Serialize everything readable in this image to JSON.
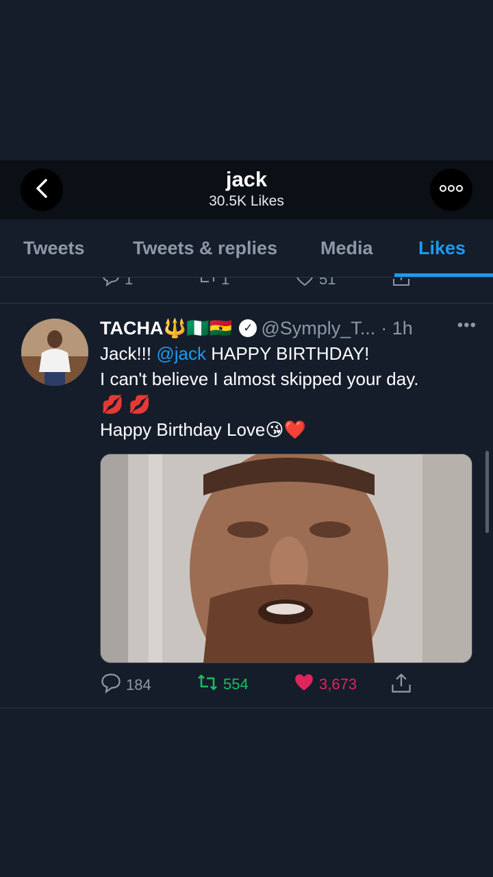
{
  "header": {
    "title": "jack",
    "subtitle": "30.5K Likes",
    "back_icon": "chevron-left-icon",
    "more_icon": "more-horizontal-icon"
  },
  "tabs": [
    {
      "label": "Tweets",
      "active": false
    },
    {
      "label": "Tweets & replies",
      "active": false
    },
    {
      "label": "Media",
      "active": false
    },
    {
      "label": "Likes",
      "active": true
    }
  ],
  "previous_tweet": {
    "replies": "1",
    "retweets": "1",
    "likes": "51"
  },
  "tweet": {
    "author_name": "TACHA🔱🇳🇬🇬🇭",
    "handle": "@Symply_T...",
    "time": "· 1h",
    "line1_prefix": "Jack!!! ",
    "mention": "@jack",
    "line1_suffix": " HAPPY BIRTHDAY!",
    "line2": "I can't believe I almost skipped your day.",
    "line3": "💋 💋",
    "line4": " Happy Birthday Love😘❤️",
    "replies": "184",
    "retweets": "554",
    "likes": "3,673"
  },
  "colors": {
    "background": "#151d2b",
    "accent": "#1d9bf0",
    "retweet": "#17bf63",
    "like": "#e0245e",
    "muted": "#8d99a6"
  }
}
